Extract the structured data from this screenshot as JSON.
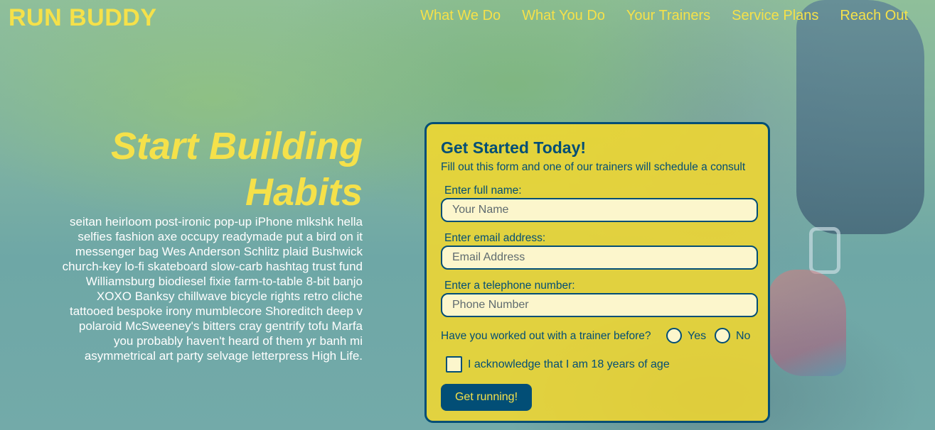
{
  "header": {
    "logo": "RUN BUDDY",
    "nav": [
      "What We Do",
      "What You Do",
      "Your Trainers",
      "Service Plans",
      "Reach Out"
    ]
  },
  "hero": {
    "title_line1": "Start Building",
    "title_line2": "Habits",
    "body": "seitan heirloom post-ironic pop-up iPhone mlkshk hella selfies fashion axe occupy readymade put a bird on it messenger bag Wes Anderson Schlitz plaid Bushwick church-key lo-fi skateboard slow-carb hashtag trust fund Williamsburg biodiesel fixie farm-to-table 8-bit banjo XOXO Banksy chillwave bicycle rights retro cliche tattooed bespoke irony mumblecore Shoreditch deep v polaroid McSweeney's bitters cray gentrify tofu Marfa you probably haven't heard of them yr banh mi asymmetrical art party selvage letterpress High Life."
  },
  "form": {
    "title": "Get Started Today!",
    "subtitle": "Fill out this form and one of our trainers will schedule a consult",
    "name": {
      "label": "Enter full name:",
      "placeholder": "Your Name",
      "value": ""
    },
    "email": {
      "label": "Enter email address:",
      "placeholder": "Email Address",
      "value": ""
    },
    "phone": {
      "label": "Enter a telephone number:",
      "placeholder": "Phone Number",
      "value": ""
    },
    "question": "Have you worked out with a trainer before?",
    "options": [
      "Yes",
      "No"
    ],
    "acknowledge": "I acknowledge that I am 18 years of age",
    "submit": "Get running!"
  },
  "colors": {
    "brand_yellow": "#f5e14a",
    "brand_blue": "#024e76",
    "form_bg": "#fada28"
  }
}
